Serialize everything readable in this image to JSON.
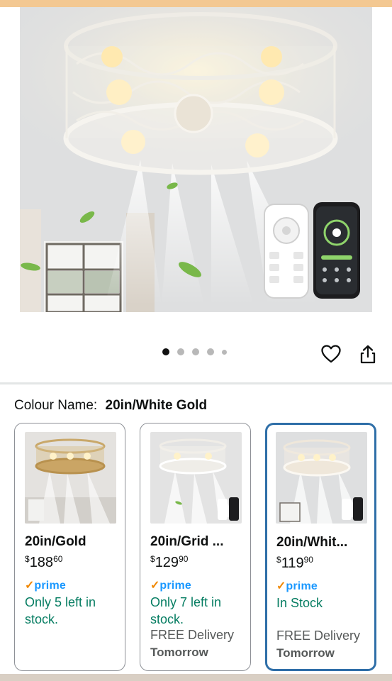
{
  "product": {
    "image_alt": "Caged ceiling fan with light, remote control and phone app",
    "gallery_count": 5,
    "active_index": 0
  },
  "actions": {
    "favorite_icon": "heart-outline-icon",
    "share_icon": "share-icon"
  },
  "colour": {
    "label": "Colour Name:",
    "selected": "20in/White Gold"
  },
  "variants": [
    {
      "title": "20in/Gold",
      "price_symbol": "$",
      "price_whole": "188",
      "price_fraction": "60",
      "prime_check": "✓",
      "prime_word": "prime",
      "stock": "Only 5 left in stock.",
      "delivery": "",
      "delivery_day": "",
      "selected": false,
      "finish_color": "#c9a86a"
    },
    {
      "title": "20in/Grid ...",
      "price_symbol": "$",
      "price_whole": "129",
      "price_fraction": "90",
      "prime_check": "✓",
      "prime_word": "prime",
      "stock": "Only 7 left in stock.",
      "delivery": "FREE Delivery",
      "delivery_day": "Tomorrow",
      "selected": false,
      "finish_color": "#e9e6df"
    },
    {
      "title": "20in/Whit...",
      "price_symbol": "$",
      "price_whole": "119",
      "price_fraction": "90",
      "prime_check": "✓",
      "prime_word": "prime",
      "stock": "In Stock",
      "delivery": "FREE Delivery",
      "delivery_day": "Tomorrow",
      "selected": true,
      "finish_color": "#efe7da"
    }
  ],
  "colors": {
    "stock_green": "#067d62",
    "prime_blue": "#1a98ff",
    "prime_orange": "#f08804",
    "selected_border": "#2f6fa8"
  }
}
